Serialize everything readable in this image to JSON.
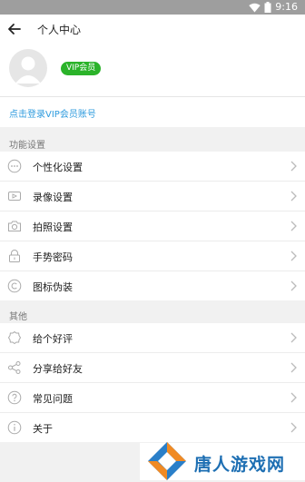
{
  "status_bar": {
    "time": "9:16",
    "icons": [
      "wifi-icon",
      "battery-icon"
    ]
  },
  "app_bar": {
    "title": "个人中心"
  },
  "profile": {
    "vip_badge": "VIP会员"
  },
  "login_link": "点击登录VIP会员账号",
  "sections": [
    {
      "title": "功能设置",
      "items": [
        {
          "label": "个性化设置",
          "icon": "more-dots-icon"
        },
        {
          "label": "录像设置",
          "icon": "video-camera-icon"
        },
        {
          "label": "拍照设置",
          "icon": "camera-icon"
        },
        {
          "label": "手势密码",
          "icon": "lock-icon"
        },
        {
          "label": "图标伪装",
          "icon": "copyright-icon"
        }
      ]
    },
    {
      "title": "其他",
      "items": [
        {
          "label": "给个好评",
          "icon": "badge-icon"
        },
        {
          "label": "分享给好友",
          "icon": "share-icon"
        },
        {
          "label": "常见问题",
          "icon": "question-icon"
        },
        {
          "label": "关于",
          "icon": "info-icon"
        }
      ]
    }
  ],
  "watermark": {
    "text": "唐人游戏网"
  },
  "colors": {
    "accent_green": "#2bb32a",
    "link_blue": "#2e9bde",
    "status_bar": "#9e9e9e"
  }
}
